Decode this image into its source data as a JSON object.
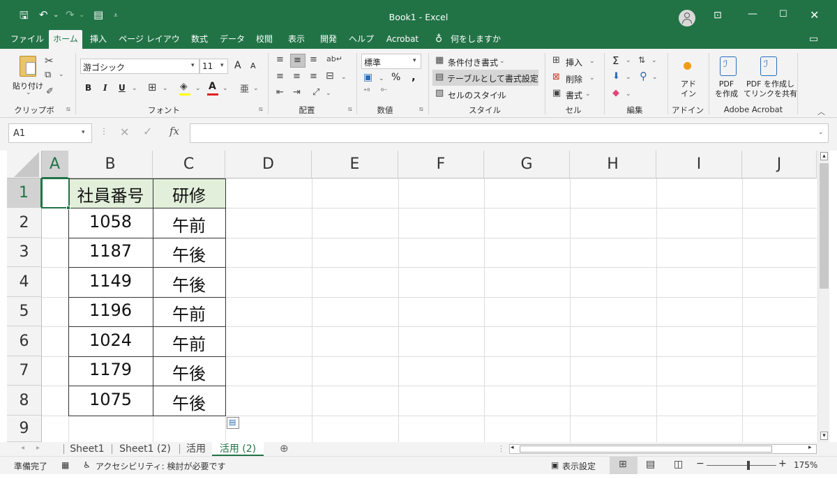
{
  "window": {
    "title": "Book1  -  Excel"
  },
  "menu_tabs": [
    "ファイル",
    "ホーム",
    "挿入",
    "ページ レイアウト",
    "数式",
    "データ",
    "校閲",
    "表示",
    "開発",
    "ヘルプ",
    "Acrobat"
  ],
  "tell_me": "何をしますか",
  "ribbon": {
    "paste": "貼り付け",
    "clipboard": "クリップボード",
    "font_name": "游ゴシック",
    "font_size": "11",
    "font_group": "フォント",
    "align_group": "配置",
    "number_format": "標準",
    "number_group": "数値",
    "cond_format": "条件付き書式",
    "table_format": "テーブルとして書式設定",
    "cell_styles": "セルのスタイル",
    "styles_group": "スタイル",
    "insert": "挿入",
    "delete": "削除",
    "format": "書式",
    "cells_group": "セル",
    "edit_group": "編集",
    "addin": "アド\nイン",
    "addin_group": "アドイン",
    "pdf_create": "PDF\nを作成",
    "pdf_share": "PDF を作成し\nてリンクを共有",
    "acrobat_group": "Adobe Acrobat",
    "bold": "B",
    "italic": "I",
    "underline": "U",
    "percent": "%",
    "comma": ",",
    "font_grow": "A",
    "font_shrink": "A",
    "font_color": "A",
    "sigma": "Σ"
  },
  "formula_bar": {
    "name_box": "A1",
    "fx": "fx",
    "formula": ""
  },
  "columns": [
    "A",
    "B",
    "C",
    "D",
    "E",
    "F",
    "G",
    "H",
    "I",
    "J"
  ],
  "rows": [
    "1",
    "2",
    "3",
    "4",
    "5",
    "6",
    "7",
    "8",
    "9"
  ],
  "table": {
    "headers": [
      "社員番号",
      "研修"
    ],
    "data": [
      [
        "1058",
        "午前"
      ],
      [
        "1187",
        "午後"
      ],
      [
        "1149",
        "午後"
      ],
      [
        "1196",
        "午前"
      ],
      [
        "1024",
        "午前"
      ],
      [
        "1179",
        "午後"
      ],
      [
        "1075",
        "午後"
      ]
    ]
  },
  "sheets": [
    "Sheet1",
    "Sheet1 (2)",
    "活用",
    "活用 (2)"
  ],
  "active_sheet": "活用 (2)",
  "status": {
    "ready": "準備完了",
    "accessibility": "アクセシビリティ: 検討が必要です",
    "display_settings": "表示設定",
    "zoom": "175%"
  },
  "colors": {
    "excel_green": "#217346",
    "header_fill": "#e2efda"
  }
}
